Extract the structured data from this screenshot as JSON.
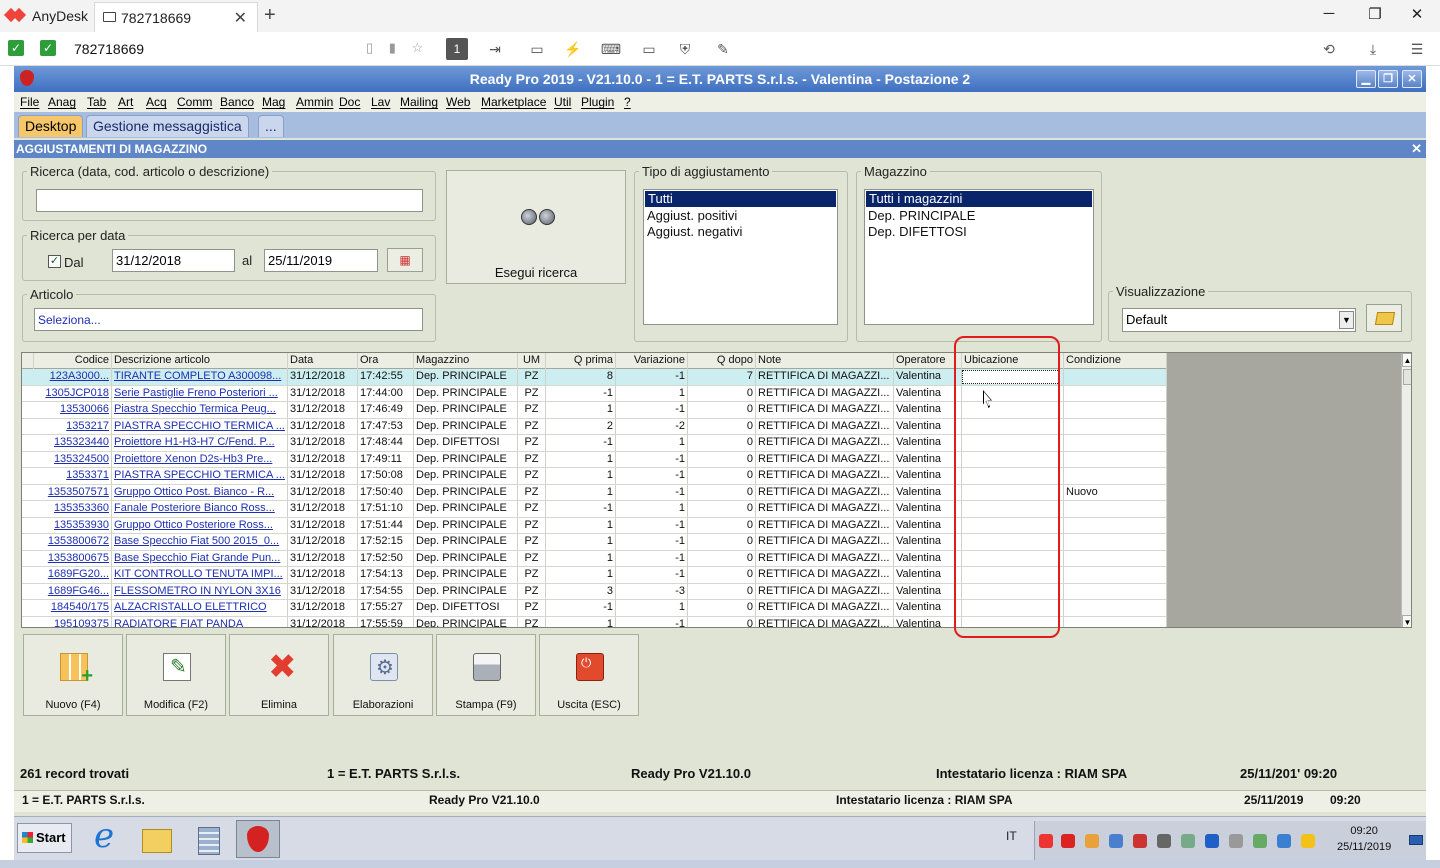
{
  "anydesk": {
    "app_name": "AnyDesk",
    "tab_label": "782718669",
    "address_value": "782718669",
    "toolbar_display_label": "1"
  },
  "app": {
    "title": "Ready Pro 2019 - V21.10.0 - 1 = E.T. PARTS S.r.l.s. - Valentina - Postazione 2",
    "menu": [
      "File",
      "Anag",
      "Tab",
      "Art",
      "Acq",
      "Comm",
      "Banco",
      "Mag",
      "Ammin",
      "Doc",
      "Lav",
      "Mailing",
      "Web",
      "Marketplace",
      "Util",
      "Plugin",
      "?"
    ],
    "tabs": [
      "Desktop",
      "Gestione messaggistica",
      "..."
    ],
    "window_title": "AGGIUSTAMENTI DI MAGAZZINO"
  },
  "filters": {
    "search_legend": "Ricerca (data, cod. articolo o descrizione)",
    "search_value": "",
    "date_legend": "Ricerca per data",
    "dal_label": "Dal",
    "dal_checked": true,
    "date_from": "31/12/2018",
    "al_label": "al",
    "date_to": "25/11/2019",
    "article_legend": "Articolo",
    "article_value": "Seleziona...",
    "search_button": "Esegui ricerca",
    "type_legend": "Tipo di aggiustamento",
    "type_options": [
      "Tutti",
      "Aggiust. positivi",
      "Aggiust. negativi"
    ],
    "type_selected": 0,
    "warehouse_legend": "Magazzino",
    "warehouse_options": [
      "Tutti i magazzini",
      "Dep. PRINCIPALE",
      "Dep. DIFETTOSI"
    ],
    "warehouse_selected": 0,
    "view_legend": "Visualizzazione",
    "view_value": "Default"
  },
  "grid": {
    "columns": [
      "Codice",
      "Descrizione articolo",
      "Data",
      "Ora",
      "Magazzino",
      "UM",
      "Q prima",
      "Variazione",
      "Q dopo",
      "Note",
      "Operatore",
      "Ubicazione",
      "Condizione"
    ],
    "rows": [
      [
        "123A3000...",
        "TIRANTE COMPLETO A300098...",
        "31/12/2018",
        "17:42:55",
        "Dep. PRINCIPALE",
        "PZ",
        "8",
        "-1",
        "7",
        "RETTIFICA DI MAGAZZI...",
        "Valentina",
        "",
        ""
      ],
      [
        "1305JCP018",
        "Serie Pastiglie Freno Posteriori ...",
        "31/12/2018",
        "17:44:00",
        "Dep. PRINCIPALE",
        "PZ",
        "-1",
        "1",
        "0",
        "RETTIFICA DI MAGAZZI...",
        "Valentina",
        "",
        ""
      ],
      [
        "13530066",
        "Piastra Specchio Termica Peug...",
        "31/12/2018",
        "17:46:49",
        "Dep. PRINCIPALE",
        "PZ",
        "1",
        "-1",
        "0",
        "RETTIFICA DI MAGAZZI...",
        "Valentina",
        "",
        ""
      ],
      [
        "1353217",
        "PIASTRA SPECCHIO TERMICA ...",
        "31/12/2018",
        "17:47:53",
        "Dep. PRINCIPALE",
        "PZ",
        "2",
        "-2",
        "0",
        "RETTIFICA DI MAGAZZI...",
        "Valentina",
        "",
        ""
      ],
      [
        "135323440",
        "Proiettore H1-H3-H7 C/Fend. P...",
        "31/12/2018",
        "17:48:44",
        "Dep. DIFETTOSI",
        "PZ",
        "-1",
        "1",
        "0",
        "RETTIFICA DI MAGAZZI...",
        "Valentina",
        "",
        ""
      ],
      [
        "135324500",
        "Proiettore Xenon D2s-Hb3 Pre...",
        "31/12/2018",
        "17:49:11",
        "Dep. PRINCIPALE",
        "PZ",
        "1",
        "-1",
        "0",
        "RETTIFICA DI MAGAZZI...",
        "Valentina",
        "",
        ""
      ],
      [
        "1353371",
        "PIASTRA SPECCHIO TERMICA ...",
        "31/12/2018",
        "17:50:08",
        "Dep. PRINCIPALE",
        "PZ",
        "1",
        "-1",
        "0",
        "RETTIFICA DI MAGAZZI...",
        "Valentina",
        "",
        ""
      ],
      [
        "1353507571",
        "Gruppo Ottico Post. Bianco - R...",
        "31/12/2018",
        "17:50:40",
        "Dep. PRINCIPALE",
        "PZ",
        "1",
        "-1",
        "0",
        "RETTIFICA DI MAGAZZI...",
        "Valentina",
        "",
        "Nuovo"
      ],
      [
        "135353360",
        "Fanale Posteriore Bianco Ross...",
        "31/12/2018",
        "17:51:10",
        "Dep. PRINCIPALE",
        "PZ",
        "-1",
        "1",
        "0",
        "RETTIFICA DI MAGAZZI...",
        "Valentina",
        "",
        ""
      ],
      [
        "135353930",
        "Gruppo Ottico Posteriore Ross...",
        "31/12/2018",
        "17:51:44",
        "Dep. PRINCIPALE",
        "PZ",
        "1",
        "-1",
        "0",
        "RETTIFICA DI MAGAZZI...",
        "Valentina",
        "",
        ""
      ],
      [
        "1353800672",
        "Base Specchio Fiat 500 2015_0...",
        "31/12/2018",
        "17:52:15",
        "Dep. PRINCIPALE",
        "PZ",
        "1",
        "-1",
        "0",
        "RETTIFICA DI MAGAZZI...",
        "Valentina",
        "",
        ""
      ],
      [
        "1353800675",
        "Base Specchio Fiat Grande Pun...",
        "31/12/2018",
        "17:52:50",
        "Dep. PRINCIPALE",
        "PZ",
        "1",
        "-1",
        "0",
        "RETTIFICA DI MAGAZZI...",
        "Valentina",
        "",
        ""
      ],
      [
        "1689FG20...",
        "KIT CONTROLLO TENUTA IMPI...",
        "31/12/2018",
        "17:54:13",
        "Dep. PRINCIPALE",
        "PZ",
        "1",
        "-1",
        "0",
        "RETTIFICA DI MAGAZZI...",
        "Valentina",
        "",
        ""
      ],
      [
        "1689FG46...",
        "FLESSOMETRO IN NYLON 3X16",
        "31/12/2018",
        "17:54:55",
        "Dep. PRINCIPALE",
        "PZ",
        "3",
        "-3",
        "0",
        "RETTIFICA DI MAGAZZI...",
        "Valentina",
        "",
        ""
      ],
      [
        "184540/175",
        "ALZACRISTALLO ELETTRICO",
        "31/12/2018",
        "17:55:27",
        "Dep. DIFETTOSI",
        "PZ",
        "-1",
        "1",
        "0",
        "RETTIFICA DI MAGAZZI...",
        "Valentina",
        "",
        ""
      ],
      [
        "195109375",
        "RADIATORE FIAT PANDA",
        "31/12/2018",
        "17:55:59",
        "Dep. PRINCIPALE",
        "PZ",
        "1",
        "-1",
        "0",
        "RETTIFICA DI MAGAZZI...",
        "Valentina",
        "",
        ""
      ]
    ]
  },
  "actions": [
    {
      "id": "nuovo",
      "label": "Nuovo (F4)",
      "icon": "grid-add-icon"
    },
    {
      "id": "modifica",
      "label": "Modifica (F2)",
      "icon": "edit-icon"
    },
    {
      "id": "elimina",
      "label": "Elimina",
      "icon": "delete-icon"
    },
    {
      "id": "elaborazioni",
      "label": "Elaborazioni",
      "icon": "process-icon"
    },
    {
      "id": "stampa",
      "label": "Stampa (F9)",
      "icon": "printer-icon"
    },
    {
      "id": "uscita",
      "label": "Uscita (ESC)",
      "icon": "power-icon"
    }
  ],
  "status": {
    "records": "261 record trovati",
    "company": "1 = E.T. PARTS S.r.l.s.",
    "version": "Ready Pro V21.10.0",
    "license": "Intestatario licenza : RIAM SPA",
    "datetime_clipped": "25/11/201' 09:20",
    "company2": "1 = E.T. PARTS S.r.l.s.",
    "version2": "Ready Pro V21.10.0",
    "license2": "Intestatario licenza : RIAM SPA",
    "date2": "25/11/2019",
    "time2": "09:20"
  },
  "taskbar": {
    "start": "Start",
    "lang": "IT",
    "clock_time": "09:20",
    "clock_date": "25/11/2019"
  }
}
